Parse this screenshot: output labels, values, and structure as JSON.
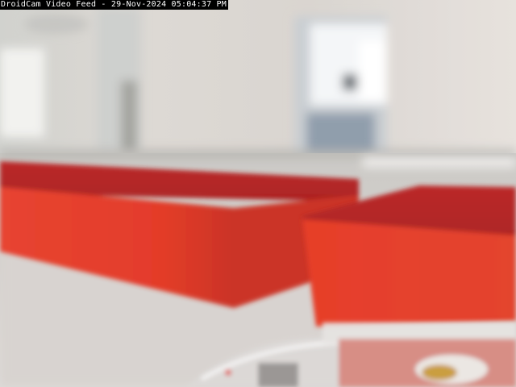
{
  "feed": {
    "app_name": "DroidCam Video Feed",
    "separator": " - ",
    "date": "29-Nov-2024",
    "time": "05:04:37 PM"
  },
  "colors": {
    "caption_background": "#000000",
    "caption_text": "#ffffff",
    "object_red": "#e8321f"
  }
}
